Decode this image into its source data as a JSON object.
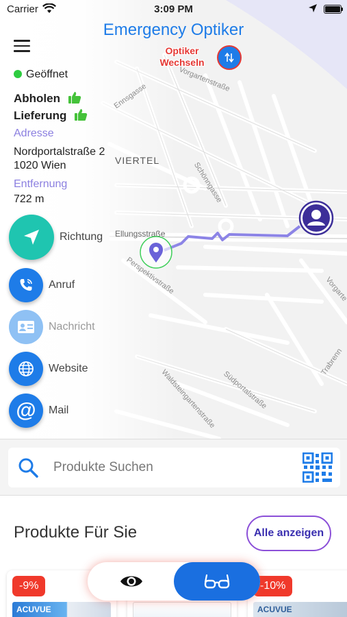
{
  "status_bar": {
    "carrier": "Carrier",
    "time": "3:09 PM"
  },
  "header": {
    "title": "Emergency Optiker",
    "switch_label": "Optiker\nWechseln"
  },
  "map": {
    "street_labels": [
      "Vorgartenstraße",
      "Ennsgasse",
      "VIERTEL",
      "Schönngasse",
      "Ellungsstraße",
      "Perspektivstraße",
      "Vorgarte",
      "Waldsteingartenstraße",
      "Südportalstraße",
      "Trabrenn"
    ]
  },
  "store": {
    "status": "Geöffnet",
    "pickup": "Abholen",
    "delivery": "Lieferung",
    "address_label": "Adresse",
    "address_line1": "Nordportalstraße 2",
    "address_line2": "1020 Wien",
    "distance_label": "Entfernung",
    "distance_value": "722 m"
  },
  "actions": {
    "directions": "Richtung",
    "call": "Anruf",
    "message": "Nachricht",
    "website": "Website",
    "mail": "Mail"
  },
  "search": {
    "placeholder": "Produkte Suchen"
  },
  "products": {
    "title": "Produkte Für Sie",
    "show_all": "Alle anzeigen",
    "items": [
      {
        "discount": "-9%"
      },
      {
        "discount": ""
      },
      {
        "discount": "-10%"
      }
    ]
  },
  "colors": {
    "accent": "#1e7ce8",
    "teal": "#1fc5b0",
    "purple": "#8b7fe0",
    "red": "#e53935",
    "green": "#2ecc40"
  },
  "icons": [
    "menu-icon",
    "switch-icon",
    "thumbs-up-icon",
    "navigation-arrow-icon",
    "phone-icon",
    "contact-card-icon",
    "globe-icon",
    "at-icon",
    "search-icon",
    "qr-code-icon",
    "eye-icon",
    "glasses-icon",
    "user-location-icon",
    "store-pin-icon"
  ]
}
